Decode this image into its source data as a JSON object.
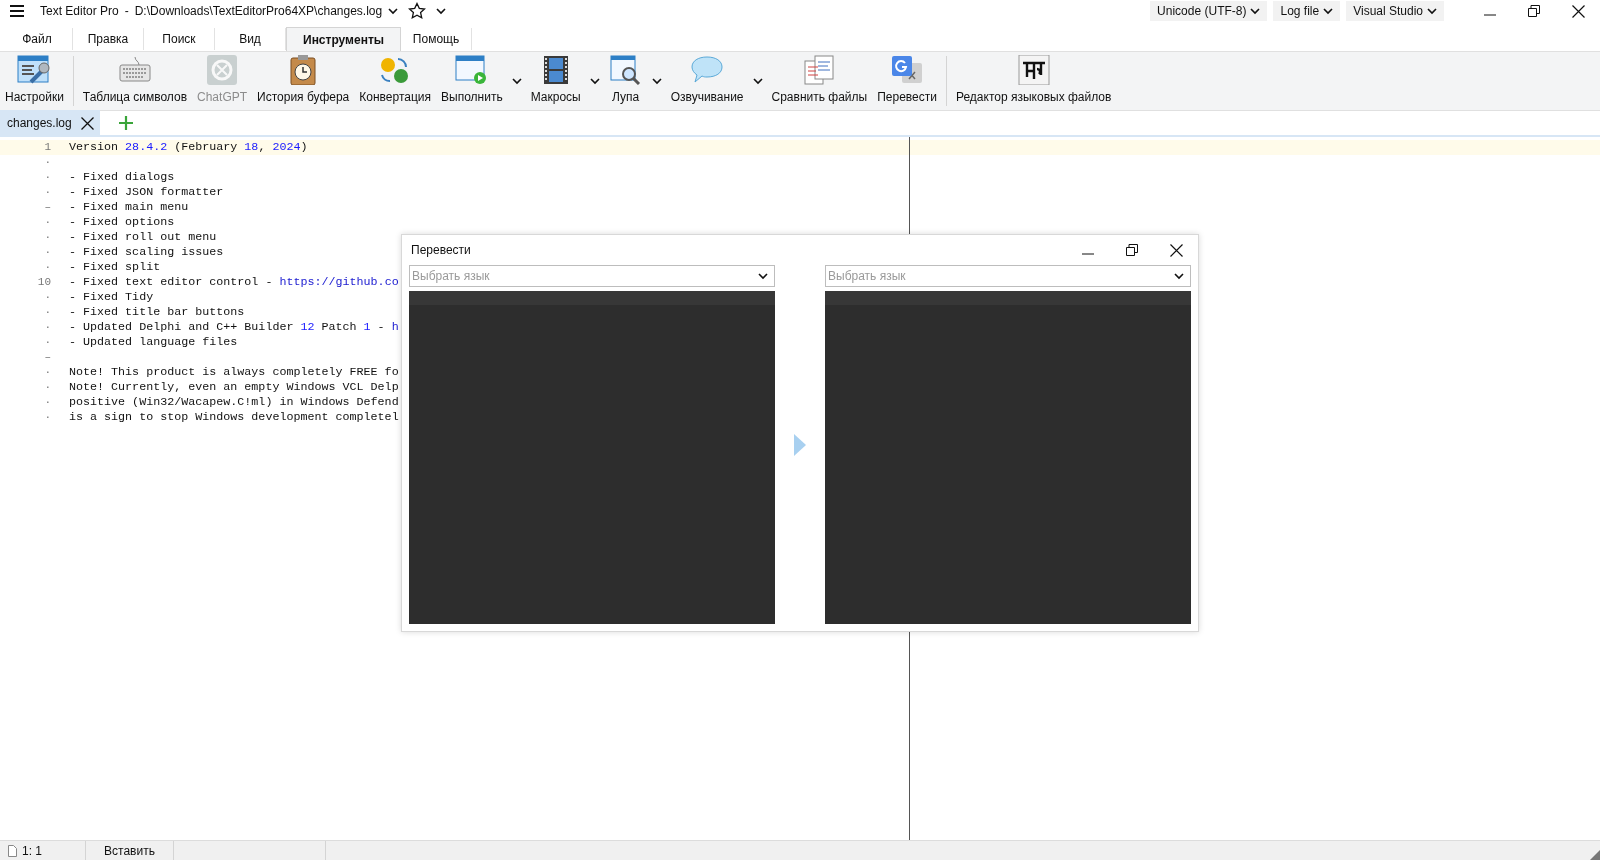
{
  "window": {
    "title": "Text Editor Pro",
    "separator": "-",
    "path": "D:\\Downloads\\TextEditorPro64XP\\changes.log",
    "selectors": [
      "Unicode (UTF-8)",
      "Log file",
      "Visual Studio"
    ]
  },
  "menu_tabs": [
    {
      "label": "Файл",
      "selected": false
    },
    {
      "label": "Правка",
      "selected": false
    },
    {
      "label": "Поиск",
      "selected": false
    },
    {
      "label": "Вид",
      "selected": false
    },
    {
      "label": "Инструменты",
      "selected": true
    },
    {
      "label": "Помощь",
      "selected": false
    }
  ],
  "toolbar": [
    {
      "kind": "tool",
      "label": "Настройки",
      "disabled": false,
      "has_menu": false
    },
    {
      "kind": "separator"
    },
    {
      "kind": "tool",
      "label": "Таблица символов",
      "disabled": false,
      "has_menu": false
    },
    {
      "kind": "tool",
      "label": "ChatGPT",
      "disabled": true,
      "has_menu": false
    },
    {
      "kind": "tool",
      "label": "История буфера",
      "disabled": false,
      "has_menu": false
    },
    {
      "kind": "tool",
      "label": "Конвертация",
      "disabled": false,
      "has_menu": false
    },
    {
      "kind": "tool",
      "label": "Выполнить",
      "disabled": false,
      "has_menu": true
    },
    {
      "kind": "tool",
      "label": "Макросы",
      "disabled": false,
      "has_menu": true
    },
    {
      "kind": "tool",
      "label": "Лупа",
      "disabled": false,
      "has_menu": true
    },
    {
      "kind": "tool",
      "label": "Озвучивание",
      "disabled": false,
      "has_menu": true
    },
    {
      "kind": "tool",
      "label": "Сравнить файлы",
      "disabled": false,
      "has_menu": false
    },
    {
      "kind": "tool",
      "label": "Перевести",
      "disabled": false,
      "has_menu": false
    },
    {
      "kind": "separator"
    },
    {
      "kind": "tool",
      "label": "Редактор языковых файлов",
      "disabled": false,
      "has_menu": false
    }
  ],
  "document_tabs": [
    {
      "label": "changes.log",
      "selected": true
    }
  ],
  "editor": {
    "lines": [
      {
        "gutter": "1",
        "segments": [
          {
            "kind": "text",
            "text": "Version "
          },
          {
            "kind": "number",
            "text": "28.4.2"
          },
          {
            "kind": "text",
            "text": " (February "
          },
          {
            "kind": "number",
            "text": "18"
          },
          {
            "kind": "text",
            "text": ", "
          },
          {
            "kind": "number",
            "text": "2024"
          },
          {
            "kind": "text",
            "text": ")"
          }
        ]
      },
      {
        "gutter": "·"
      },
      {
        "gutter": "·",
        "segments": [
          {
            "kind": "text",
            "text": "- Fixed dialogs"
          }
        ]
      },
      {
        "gutter": "·",
        "segments": [
          {
            "kind": "text",
            "text": "- Fixed JSON formatter"
          }
        ]
      },
      {
        "gutter": "–",
        "segments": [
          {
            "kind": "text",
            "text": "- Fixed main menu"
          }
        ]
      },
      {
        "gutter": "·",
        "segments": [
          {
            "kind": "text",
            "text": "- Fixed options"
          }
        ]
      },
      {
        "gutter": "·",
        "segments": [
          {
            "kind": "text",
            "text": "- Fixed roll out menu"
          }
        ]
      },
      {
        "gutter": "·",
        "segments": [
          {
            "kind": "text",
            "text": "- Fixed scaling issues"
          }
        ]
      },
      {
        "gutter": "·",
        "segments": [
          {
            "kind": "text",
            "text": "- Fixed split"
          }
        ]
      },
      {
        "gutter": "10",
        "segments": [
          {
            "kind": "text",
            "text": "- Fixed text editor control - "
          },
          {
            "kind": "link",
            "text": "https://github.co"
          }
        ]
      },
      {
        "gutter": "·",
        "segments": [
          {
            "kind": "text",
            "text": "- Fixed Tidy"
          }
        ]
      },
      {
        "gutter": "·",
        "segments": [
          {
            "kind": "text",
            "text": "- Fixed title bar buttons"
          }
        ]
      },
      {
        "gutter": "·",
        "segments": [
          {
            "kind": "text",
            "text": "- Updated Delphi and C++ Builder "
          },
          {
            "kind": "number",
            "text": "12"
          },
          {
            "kind": "text",
            "text": " Patch "
          },
          {
            "kind": "number",
            "text": "1"
          },
          {
            "kind": "text",
            "text": " - "
          },
          {
            "kind": "link",
            "text": "h"
          }
        ]
      },
      {
        "gutter": "·",
        "segments": [
          {
            "kind": "text",
            "text": "- Updated language files"
          }
        ]
      },
      {
        "gutter": "–"
      },
      {
        "gutter": "·",
        "segments": [
          {
            "kind": "text",
            "text": "Note! This product is always completely FREE fo"
          }
        ]
      },
      {
        "gutter": "·",
        "segments": [
          {
            "kind": "text",
            "text": "Note! Currently, even an empty Windows VCL Delp"
          }
        ]
      },
      {
        "gutter": "·",
        "segments": [
          {
            "kind": "text",
            "text": "positive (Win32/Wacapew.C!ml) in Windows Defend"
          }
        ]
      },
      {
        "gutter": "·",
        "segments": [
          {
            "kind": "text",
            "text": "is a sign to stop Windows development completel"
          }
        ]
      }
    ]
  },
  "dialog": {
    "title": "Перевести",
    "source_language": {
      "placeholder": "Выбрать язык"
    },
    "target_language": {
      "placeholder": "Выбрать язык"
    }
  },
  "status_bar": {
    "position": "1: 1",
    "mode": "Вставить"
  }
}
